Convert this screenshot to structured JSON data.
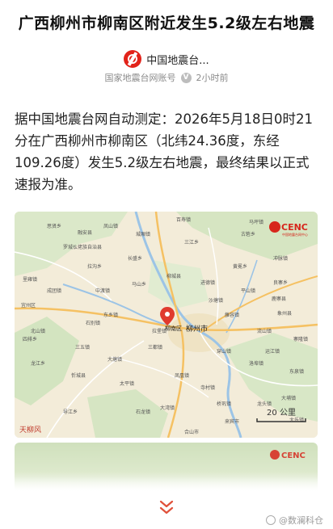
{
  "article": {
    "headline": "广西柳州市柳南区附近发生5.2级左右地震",
    "source_name": "中国地震台...",
    "source_account": "国家地震台网账号",
    "time_ago": "2小时前",
    "verified_badge": "V",
    "body": "据中国地震台网自动测定：2026年5月18日0时21分在广西柳州市柳南区（北纬24.36度，东经109.26度）发生5.2级左右地震，最终结果以正式速报为准。"
  },
  "map": {
    "logo_text": "CENC",
    "logo_subtitle": "中国地震台网中心",
    "scale_label": "20 公里",
    "corner_text": "天柳风",
    "city_labels": [
      "柳州市",
      "柳南区"
    ],
    "place_labels": [
      "罗城仫佬族自治县",
      "融安县",
      "鹿寨县",
      "柳城县",
      "宜州区",
      "忻城县",
      "合山市",
      "来宾市",
      "象州县",
      "大塘镇",
      "三都镇",
      "马山乡",
      "里雍镇",
      "沙塘镇",
      "洛埠镇",
      "拉堡镇",
      "穿山镇",
      "进德镇",
      "凤凰镇",
      "石别镇",
      "大湾镇",
      "黄冕乡",
      "中渡镇",
      "四排乡",
      "东泉镇",
      "龙头镇",
      "大埔镇",
      "思贤乡",
      "凤山镇",
      "古砦乡",
      "长盛乡",
      "冲脉镇",
      "太平镇",
      "龙江乡",
      "导江乡",
      "流山镇",
      "寨隆镇",
      "三江乡",
      "北山镇",
      "百寿镇",
      "成团镇",
      "雒容镇",
      "平山镇",
      "拉沟乡",
      "良寨乡",
      "马坪镇",
      "运江镇",
      "石龙镇",
      "寺村镇",
      "三五镇",
      "桥巩镇",
      "城厢镇",
      "东乡镇",
      "大乐镇"
    ],
    "colors": {
      "land": "#f3ecd9",
      "forest": "#cfe3bd",
      "river": "#9cc4e6",
      "road": "#ffffff",
      "highway": "#f5c163",
      "marker": "#e03a2e",
      "cenc_red": "#d7261c"
    }
  },
  "second_map": {
    "logo_text": "CENC"
  },
  "footer": {
    "watermark": "@数澜科仓"
  }
}
